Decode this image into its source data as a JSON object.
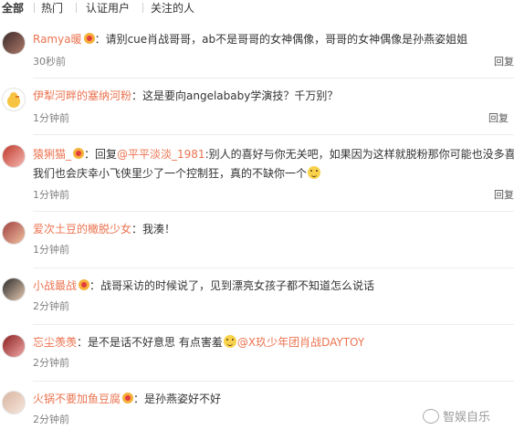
{
  "tabs": [
    "全部",
    "热门",
    "认证用户",
    "关注的人"
  ],
  "reply_label": "回复",
  "comments": [
    {
      "user": "Ramya暖",
      "text": "：请别cue肖战哥哥，ab不是哥哥的女神偶像，哥哥的女神偶像是孙燕姿姐姐",
      "time": "30秒前",
      "has_vip": true
    },
    {
      "user": "伊犁河畔的塞纳河粉",
      "text": "：这是要向angelababy学演技？千万别？",
      "time": "1分钟前",
      "has_vip": false
    },
    {
      "user": "猿猁猫_",
      "text_prefix": "：回复",
      "mention": "@平平淡淡_1981",
      "text_suffix": ":别人的喜好与你无关吧，如果因为这样就脱粉那你可能也没多喜欢",
      "text_line2": "我们也会庆幸小飞侠里少了一个控制狂，真的不缺你一个",
      "time": "1分钟前",
      "has_vip": true
    },
    {
      "user": "爱次土豆的橄脱少女",
      "text": "：我湊！",
      "time": "1分钟前",
      "has_vip": false
    },
    {
      "user": "小战最战",
      "text": "：战哥采访的时候说了，见到漂亮女孩子都不知道怎么说话",
      "time": "2分钟前",
      "has_vip": true
    },
    {
      "user": "忘尘羡羡",
      "text_prefix": "：是不是话不好意思 有点害羞",
      "mention": "@X玖少年团肖战DAYTOY",
      "time": "2分钟前",
      "has_vip": false
    },
    {
      "user": "火锅不要加鱼豆腐",
      "text": "：是孙燕姿好不好",
      "time": "2分钟前",
      "has_vip": true
    }
  ],
  "watermark": "智娱自乐",
  "colors": {
    "name": "#eb7350",
    "time": "#808080",
    "text": "#333333"
  }
}
